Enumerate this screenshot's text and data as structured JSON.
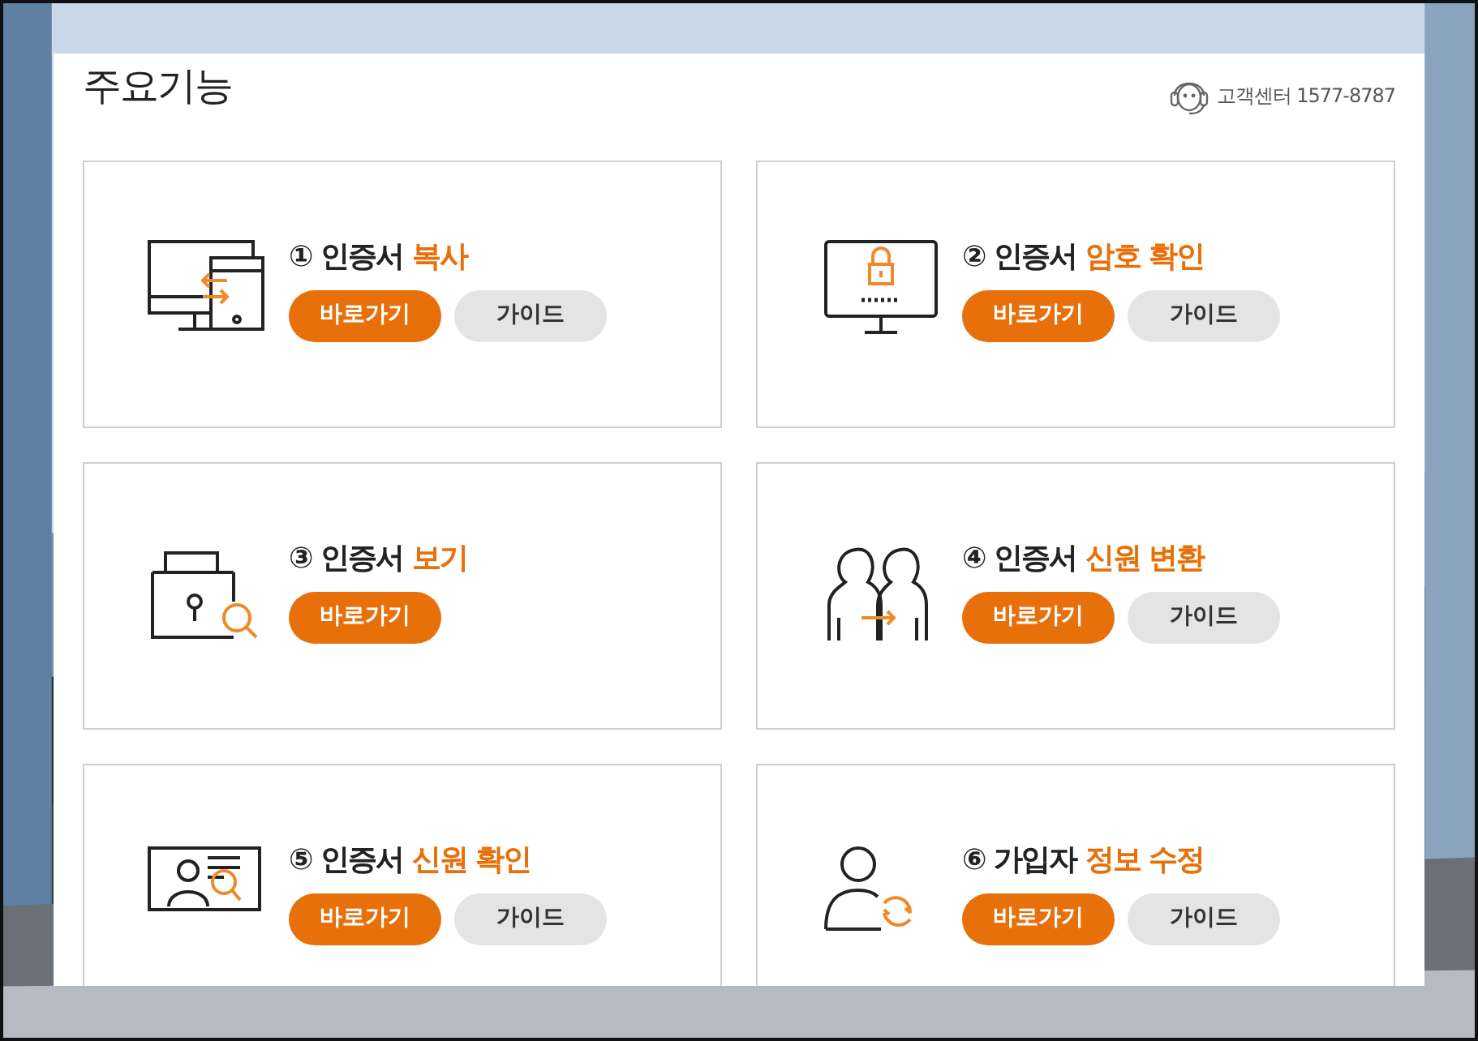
{
  "panel": {
    "title": "주요기능",
    "support": "고객센터 1577-8787"
  },
  "cards": [
    {
      "number": "①",
      "title": "인증서",
      "highlight": "복사",
      "buttons": [
        {
          "label": "바로가기",
          "kind": "primary"
        },
        {
          "label": "가이드",
          "kind": "secondary"
        }
      ]
    },
    {
      "number": "②",
      "title": "인증서",
      "highlight": "암호 확인",
      "buttons": [
        {
          "label": "바로가기",
          "kind": "primary"
        },
        {
          "label": "가이드",
          "kind": "secondary"
        }
      ]
    },
    {
      "number": "③",
      "title": "인증서",
      "highlight": "보기",
      "buttons": [
        {
          "label": "바로가기",
          "kind": "primary"
        }
      ]
    },
    {
      "number": "④",
      "title": "인증서",
      "highlight": "신원 변환",
      "buttons": [
        {
          "label": "바로가기",
          "kind": "primary"
        },
        {
          "label": "가이드",
          "kind": "secondary"
        }
      ]
    },
    {
      "number": "⑤",
      "title": "인증서",
      "highlight": "신원 확인",
      "buttons": [
        {
          "label": "바로가기",
          "kind": "primary"
        },
        {
          "label": "가이드",
          "kind": "secondary"
        }
      ]
    },
    {
      "number": "⑥",
      "title": "가입자",
      "highlight": "정보 수정",
      "buttons": [
        {
          "label": "바로가기",
          "kind": "primary"
        },
        {
          "label": "가이드",
          "kind": "secondary"
        }
      ]
    }
  ]
}
